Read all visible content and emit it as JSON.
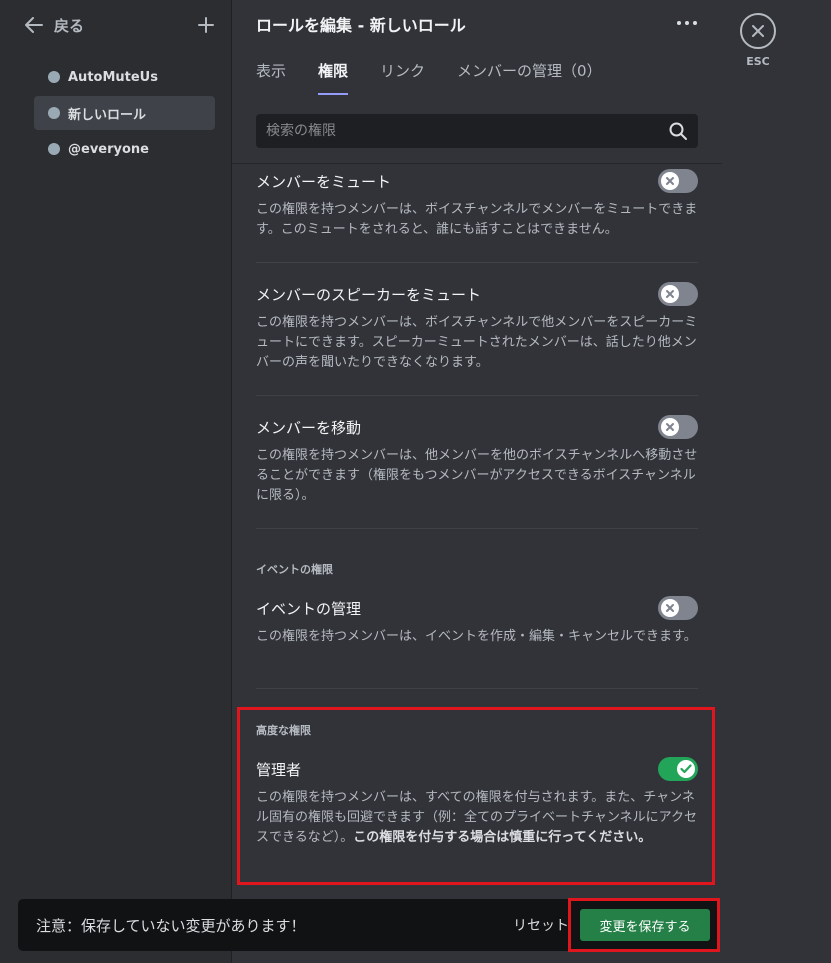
{
  "sidebar": {
    "back_label": "戻る",
    "roles": [
      {
        "name": "AutoMuteUs"
      },
      {
        "name": "新しいロール"
      },
      {
        "name": "@everyone"
      }
    ]
  },
  "header": {
    "title": "ロールを編集 - 新しいロール"
  },
  "tabs": [
    {
      "label": "表示"
    },
    {
      "label": "権限"
    },
    {
      "label": "リンク"
    },
    {
      "label": "メンバーの管理（0）"
    }
  ],
  "search": {
    "placeholder": "検索の権限"
  },
  "permissions": [
    {
      "name": "メンバーをミュート",
      "desc": "この権限を持つメンバーは、ボイスチャンネルでメンバーをミュートできます。このミュートをされると、誰にも話すことはできません。",
      "enabled": false
    },
    {
      "name": "メンバーのスピーカーをミュート",
      "desc": "この権限を持つメンバーは、ボイスチャンネルで他メンバーをスピーカーミュートにできます。スピーカーミュートされたメンバーは、話したり他メンバーの声を聞いたりできなくなります。",
      "enabled": false
    },
    {
      "name": "メンバーを移動",
      "desc": "この権限を持つメンバーは、他メンバーを他のボイスチャンネルへ移動させることができます（権限をもつメンバーがアクセスできるボイスチャンネルに限る）。",
      "enabled": false
    }
  ],
  "event_section": {
    "title": "イベントの権限",
    "permission": {
      "name": "イベントの管理",
      "desc": "この権限を持つメンバーは、イベントを作成・編集・キャンセルできます。",
      "enabled": false
    }
  },
  "advanced_section": {
    "title": "高度な権限",
    "permission": {
      "name": "管理者",
      "desc": "この権限を持つメンバーは、すべての権限を付与されます。また、チャンネル固有の権限も回避できます（例：全てのプライベートチャンネルにアクセスできるなど）。",
      "warning": "この権限を付与する場合は慎重に行ってください。",
      "enabled": true
    }
  },
  "esc": {
    "label": "ESC"
  },
  "notice": {
    "text": "注意：保存していない変更があります！",
    "reset_label": "リセット",
    "save_label": "変更を保存する"
  },
  "colors": {
    "accent": "#949cf7",
    "toggle_on": "#23a559",
    "toggle_off": "#80848e",
    "save_button": "#248046",
    "highlight": "#e0161f"
  }
}
